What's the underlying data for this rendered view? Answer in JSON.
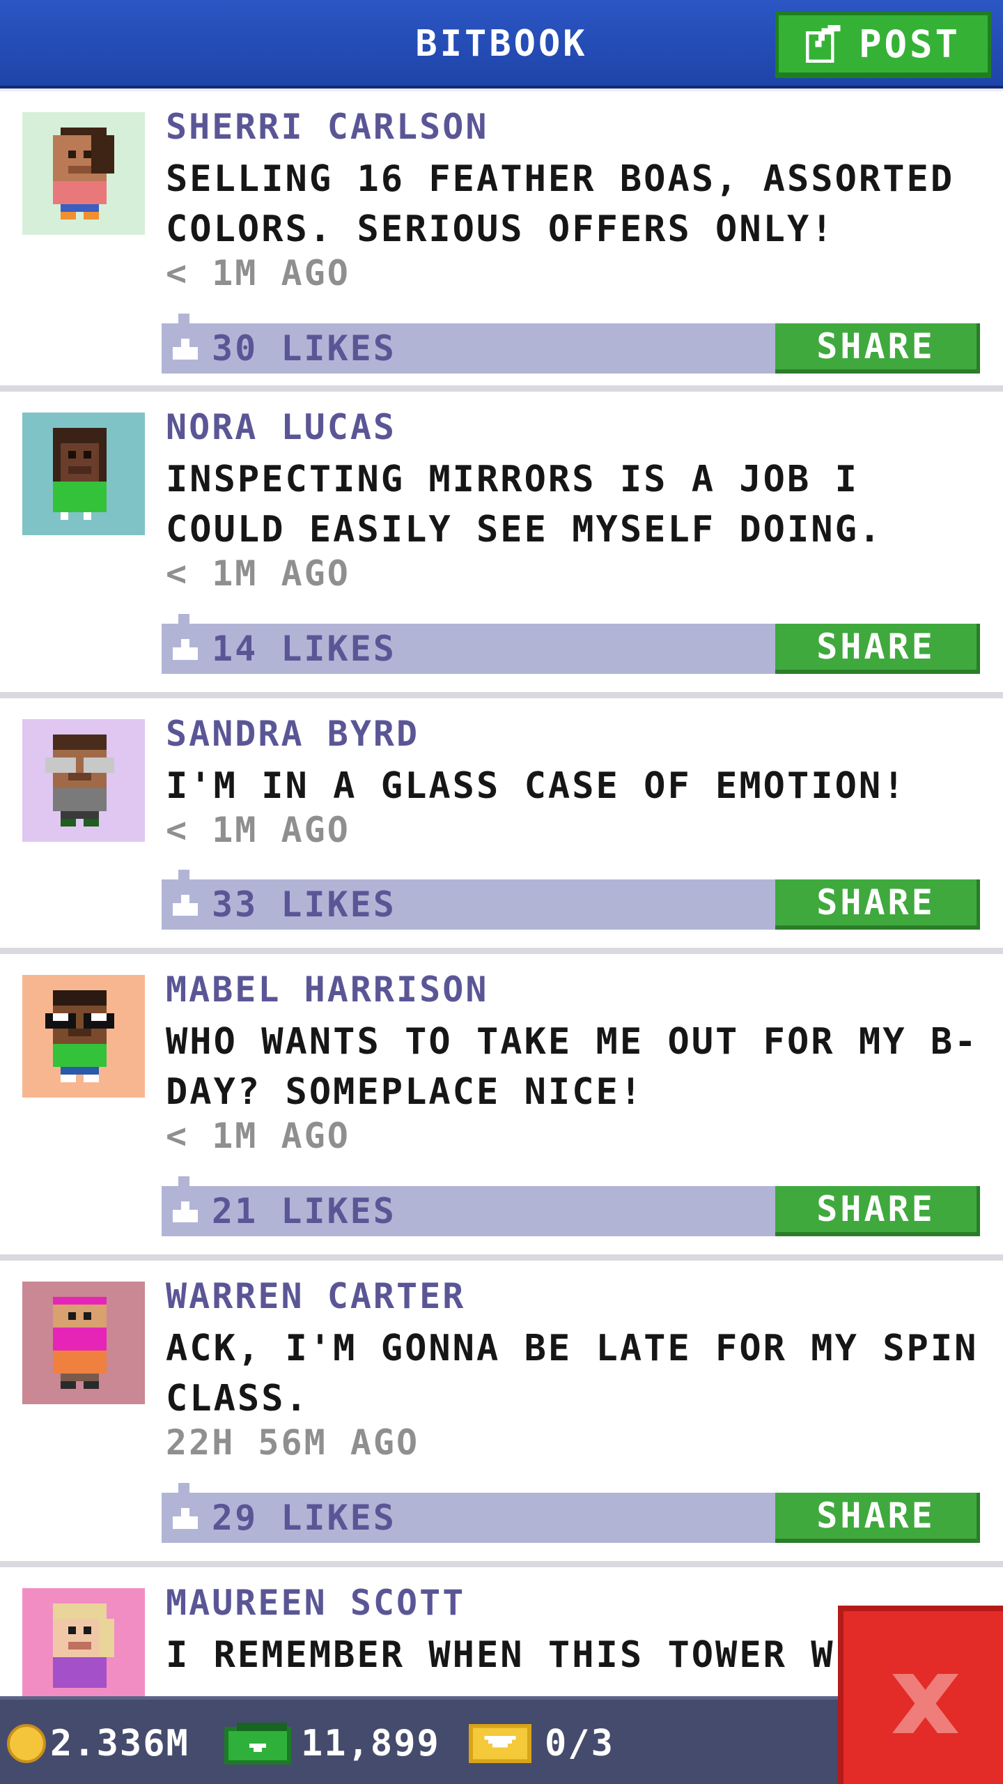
{
  "header": {
    "title": "BITBOOK",
    "post_label": "POST",
    "post_icon": "edit-square-icon"
  },
  "feed": [
    {
      "name": "SHERRI CARLSON",
      "text": "SELLING 16 FEATHER BOAS, ASSORTED COLORS. SERIOUS OFFERS ONLY!",
      "time": "< 1M AGO",
      "likes": "30 LIKES",
      "share": "SHARE",
      "avatar_bg": "#d6efd9"
    },
    {
      "name": "NORA LUCAS",
      "text": "INSPECTING MIRRORS IS A JOB I COULD EASILY SEE MYSELF DOING.",
      "time": "< 1M AGO",
      "likes": "14 LIKES",
      "share": "SHARE",
      "avatar_bg": "#80c3c6"
    },
    {
      "name": "SANDRA BYRD",
      "text": "I'M IN A GLASS CASE OF EMOTION!",
      "time": "< 1M AGO",
      "likes": "33 LIKES",
      "share": "SHARE",
      "avatar_bg": "#dfc7f1"
    },
    {
      "name": "MABEL HARRISON",
      "text": "WHO WANTS TO TAKE ME OUT FOR MY B-DAY? SOMEPLACE NICE!",
      "time": "< 1M AGO",
      "likes": "21 LIKES",
      "share": "SHARE",
      "avatar_bg": "#f8b690"
    },
    {
      "name": "WARREN CARTER",
      "text": "ACK, I'M GONNA BE LATE FOR MY SPIN CLASS.",
      "time": "22H 56M AGO",
      "likes": "29 LIKES",
      "share": "SHARE",
      "avatar_bg": "#c98893"
    },
    {
      "name": "MAUREEN SCOTT",
      "text": "I REMEMBER WHEN THIS TOWER W",
      "avatar_bg": "#f28dc4"
    }
  ],
  "status": {
    "coins": "2.336M",
    "bux": "11,899",
    "tickets": "0/3"
  },
  "icons": {
    "like": "thumbs-up-icon",
    "coin": "coin-icon",
    "bux": "bux-icon",
    "ticket": "ticket-icon",
    "close": "close-icon"
  },
  "colors": {
    "header": "#2b56c4",
    "accent_green": "#3fa93d",
    "name_purple": "#5a5696",
    "likes_bar": "#b2b4d6",
    "close_red": "#e32b28"
  }
}
